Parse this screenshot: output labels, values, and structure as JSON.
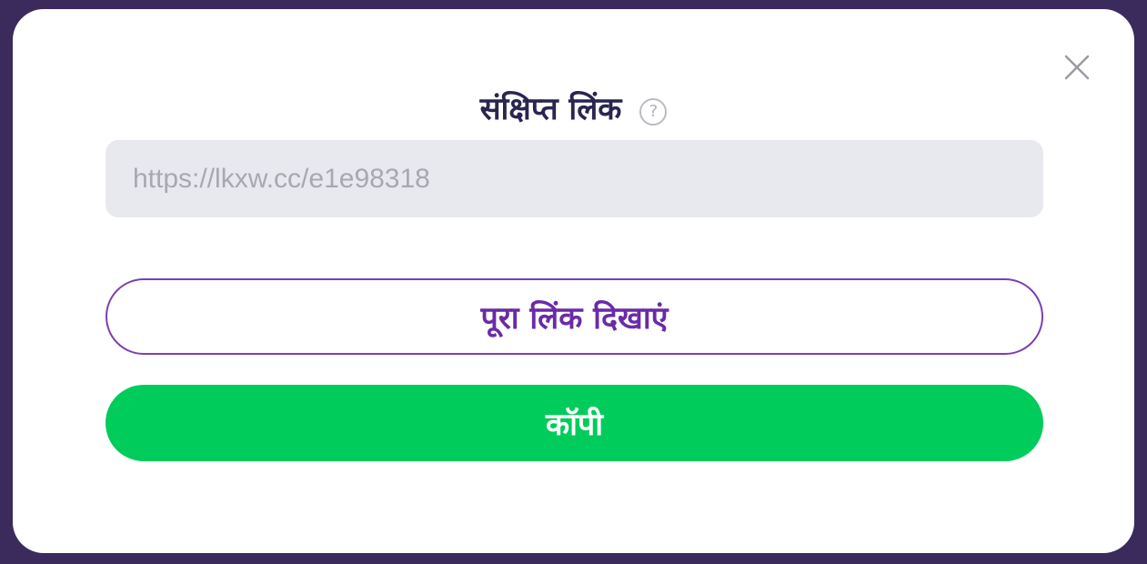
{
  "modal": {
    "title": "संक्षिप्त लिंक",
    "help_glyph": "?",
    "short_link_value": "https://lkxw.cc/e1e98318",
    "show_full_link_label": "पूरा लिंक दिखाएं",
    "copy_label": "कॉपी",
    "close_icon": "close-icon",
    "help_icon": "question-circle-icon"
  },
  "colors": {
    "backdrop": "#3b2a5c",
    "title_text": "#2a2550",
    "field_bg": "#e8e9ee",
    "field_text": "#a7a9b1",
    "outline_button_border": "#7b3fb3",
    "outline_button_text": "#6a2ba6",
    "copy_button_bg": "#00cc5c",
    "copy_button_text": "#ffffff"
  }
}
